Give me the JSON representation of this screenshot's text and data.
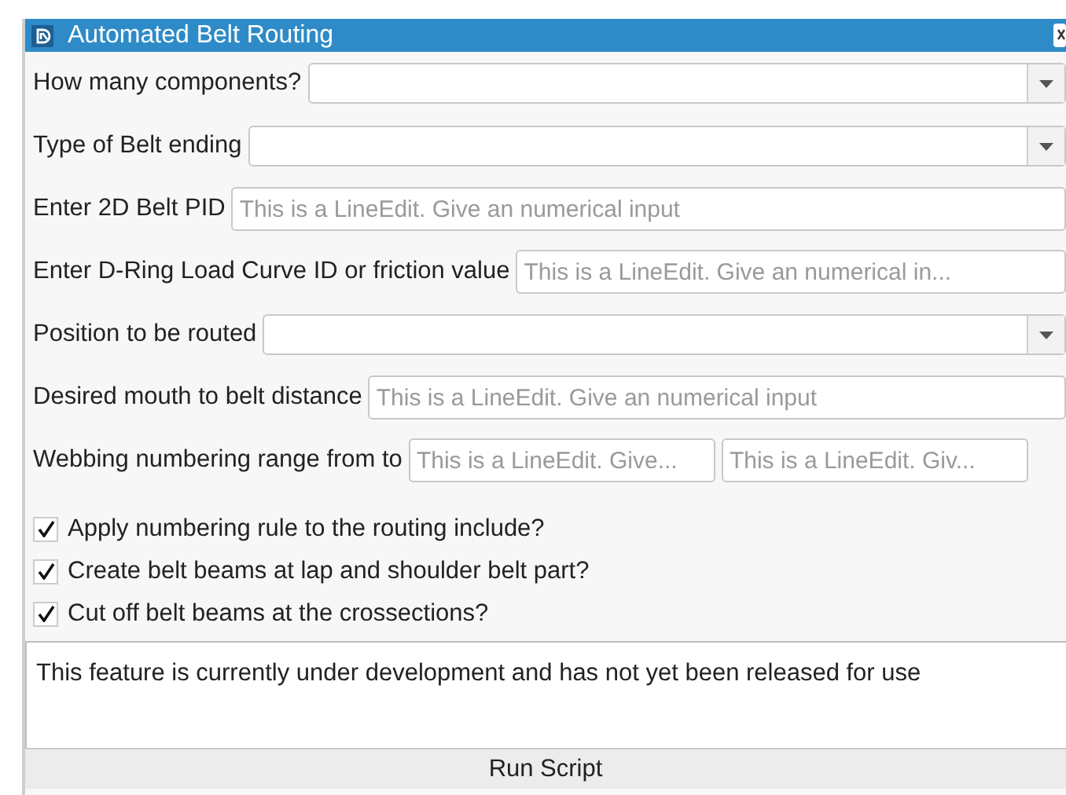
{
  "window": {
    "title": "Automated Belt Routing"
  },
  "rows": [
    {
      "label": "How many components?",
      "fields": [
        {
          "kind": "combo"
        }
      ]
    },
    {
      "label": "Type of Belt ending",
      "fields": [
        {
          "kind": "combo"
        }
      ]
    },
    {
      "label": "Enter 2D Belt PID",
      "fields": [
        {
          "kind": "line",
          "placeholder": "This is a LineEdit. Give an numerical input"
        }
      ]
    },
    {
      "label": "Enter D-Ring Load Curve ID or friction value",
      "fields": [
        {
          "kind": "line",
          "placeholder": "This is a LineEdit. Give an numerical in..."
        }
      ]
    },
    {
      "label": "Position to be routed",
      "fields": [
        {
          "kind": "combo"
        }
      ]
    },
    {
      "label": "Desired mouth to belt distance",
      "fields": [
        {
          "kind": "line",
          "placeholder": "This is a LineEdit. Give an numerical input"
        }
      ]
    },
    {
      "label": "Webbing numbering range from to",
      "fields": [
        {
          "kind": "line",
          "placeholder": "This is a LineEdit. Give..."
        },
        {
          "kind": "line",
          "placeholder": "This is a LineEdit. Giv..."
        }
      ]
    }
  ],
  "checkboxes": [
    {
      "label": "Apply numbering rule to the routing include?",
      "checked": true
    },
    {
      "label": "Create belt beams at lap and shoulder belt part?",
      "checked": true
    },
    {
      "label": "Cut off belt beams at the crossections?",
      "checked": true
    }
  ],
  "output": {
    "text": "This feature is currently under development and has not yet been released for use"
  },
  "buttons": [
    "Run Script"
  ]
}
